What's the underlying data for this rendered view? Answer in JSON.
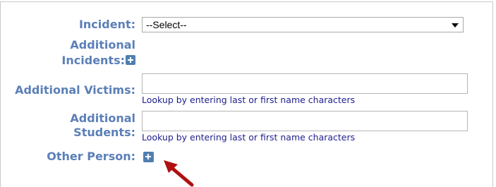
{
  "form": {
    "incident": {
      "label": "Incident:",
      "selected": "--Select--"
    },
    "additional_incidents": {
      "label_line1": "Additional",
      "label_line2": "Incidents:"
    },
    "additional_victims": {
      "label": "Additional Victims:",
      "value": "",
      "help": "Lookup by entering last or first name characters"
    },
    "additional_students": {
      "label_line1": "Additional",
      "label_line2": "Students:",
      "value": "",
      "help": "Lookup by entering last or first name characters"
    },
    "other_person": {
      "label": "Other Person:"
    }
  },
  "icons": {
    "add": "plus-square-icon",
    "annotation": "red-arrow-icon"
  },
  "colors": {
    "label": "#5b7fb8",
    "help_text": "#1e1e8c",
    "icon": "#4f7fb0",
    "annotation_arrow": "#b01010"
  }
}
